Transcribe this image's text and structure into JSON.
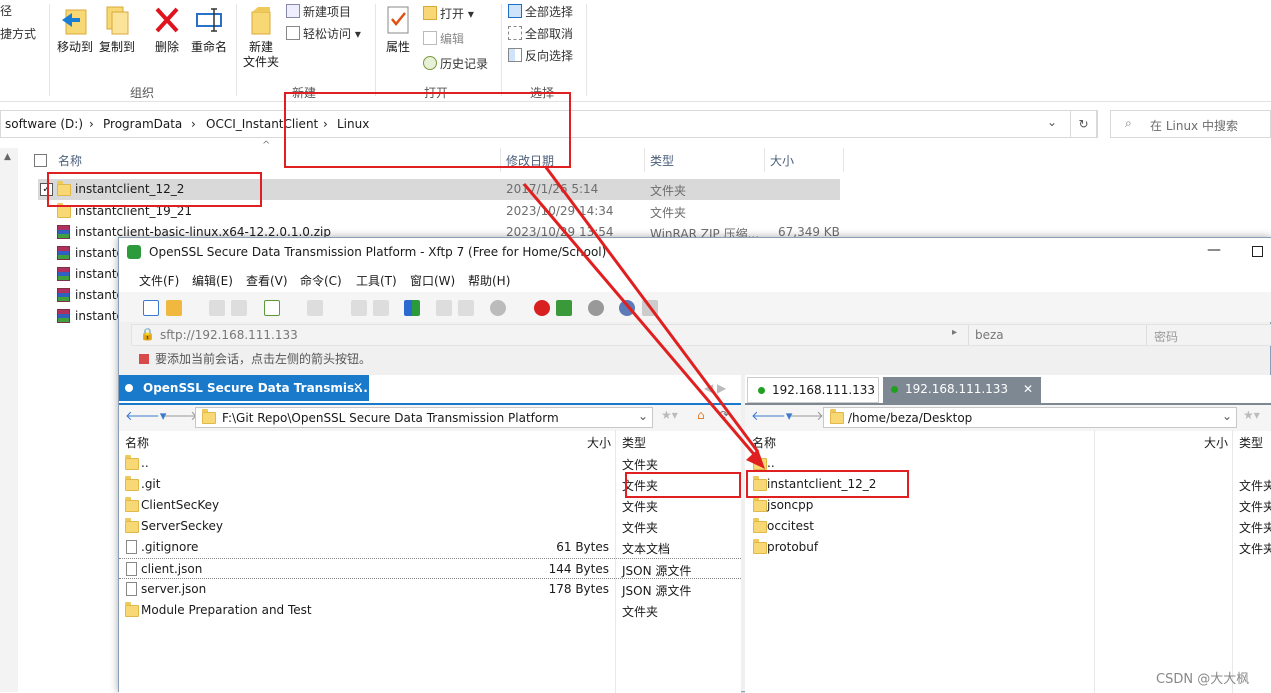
{
  "ribbon": {
    "partial_top": "径",
    "partial_bottom": "捷方式",
    "move_to": "移动到",
    "copy_to": "复制到",
    "delete": "删除",
    "rename": "重命名",
    "new_folder_l1": "新建",
    "new_folder_l2": "文件夹",
    "new_item": "新建项目",
    "easy_access": "轻松访问",
    "properties": "属性",
    "open": "打开",
    "edit": "编辑",
    "history": "历史记录",
    "select_all": "全部选择",
    "select_none": "全部取消",
    "invert_select": "反向选择",
    "groups": {
      "organize": "组织",
      "new": "新建",
      "open": "打开",
      "select": "选择"
    }
  },
  "address": {
    "crumbs": [
      "software (D:)",
      "ProgramData",
      "OCCI_InstantClient",
      "Linux"
    ],
    "search_placeholder": "在 Linux 中搜索"
  },
  "explorer": {
    "columns": {
      "name": "名称",
      "date": "修改日期",
      "type": "类型",
      "size": "大小"
    },
    "rows": [
      {
        "name": "instantclient_12_2",
        "date": "2017/1/26 5:14",
        "type": "文件夹",
        "size": ""
      },
      {
        "name": "instantclient_19_21",
        "date": "2023/10/29 14:34",
        "type": "文件夹",
        "size": ""
      },
      {
        "name": "instantclient-basic-linux.x64-12.2.0.1.0.zip",
        "date": "2023/10/29 13:54",
        "type": "WinRAR ZIP 压缩...",
        "size": "67,349 KB"
      },
      {
        "name": "instanto",
        "date": "",
        "type": "",
        "size": ""
      },
      {
        "name": "instanto",
        "date": "",
        "type": "",
        "size": ""
      },
      {
        "name": "instanto",
        "date": "",
        "type": "",
        "size": ""
      },
      {
        "name": "instanto",
        "date": "",
        "type": "",
        "size": ""
      }
    ]
  },
  "xftp": {
    "title": "OpenSSL Secure Data Transmission Platform - Xftp 7 (Free for Home/School)",
    "menu": [
      "文件(F)",
      "编辑(E)",
      "查看(V)",
      "命令(C)",
      "工具(T)",
      "窗口(W)",
      "帮助(H)"
    ],
    "url": "sftp://192.168.111.133",
    "user": "beza",
    "password_label": "密码",
    "hint": "要添加当前会话，点击左侧的箭头按钮。",
    "left": {
      "tab": "OpenSSL Secure Data Transmis...",
      "path": "F:\\Git Repo\\OpenSSL Secure Data Transmission Platform",
      "columns": {
        "name": "名称",
        "size": "大小",
        "type": "类型"
      },
      "rows": [
        {
          "name": "..",
          "size": "",
          "type": "文件夹",
          "icon": "folder"
        },
        {
          "name": ".git",
          "size": "",
          "type": "文件夹",
          "icon": "folder"
        },
        {
          "name": "ClientSecKey",
          "size": "",
          "type": "文件夹",
          "icon": "folder"
        },
        {
          "name": "ServerSeckey",
          "size": "",
          "type": "文件夹",
          "icon": "folder"
        },
        {
          "name": ".gitignore",
          "size": "61 Bytes",
          "type": "文本文档",
          "icon": "text"
        },
        {
          "name": "client.json",
          "size": "144 Bytes",
          "type": "JSON 源文件",
          "icon": "json"
        },
        {
          "name": "server.json",
          "size": "178 Bytes",
          "type": "JSON 源文件",
          "icon": "json"
        },
        {
          "name": "Module Preparation and Test",
          "size": "",
          "type": "文件夹",
          "icon": "folder"
        }
      ]
    },
    "right": {
      "tabs": [
        "192.168.111.133",
        "192.168.111.133"
      ],
      "path": "/home/beza/Desktop",
      "columns": {
        "name": "名称",
        "size": "大小",
        "type": "类型"
      },
      "rows": [
        {
          "name": "..",
          "type": ""
        },
        {
          "name": "instantclient_12_2",
          "type": "文件夹"
        },
        {
          "name": "jsoncpp",
          "type": "文件夹"
        },
        {
          "name": "occitest",
          "type": "文件夹"
        },
        {
          "name": "protobuf",
          "type": "文件夹"
        }
      ]
    }
  },
  "watermark": "CSDN @大大枫",
  "colors": {
    "accent": "#1979ca",
    "annotation": "#e02020",
    "folder": "#f8d775"
  }
}
